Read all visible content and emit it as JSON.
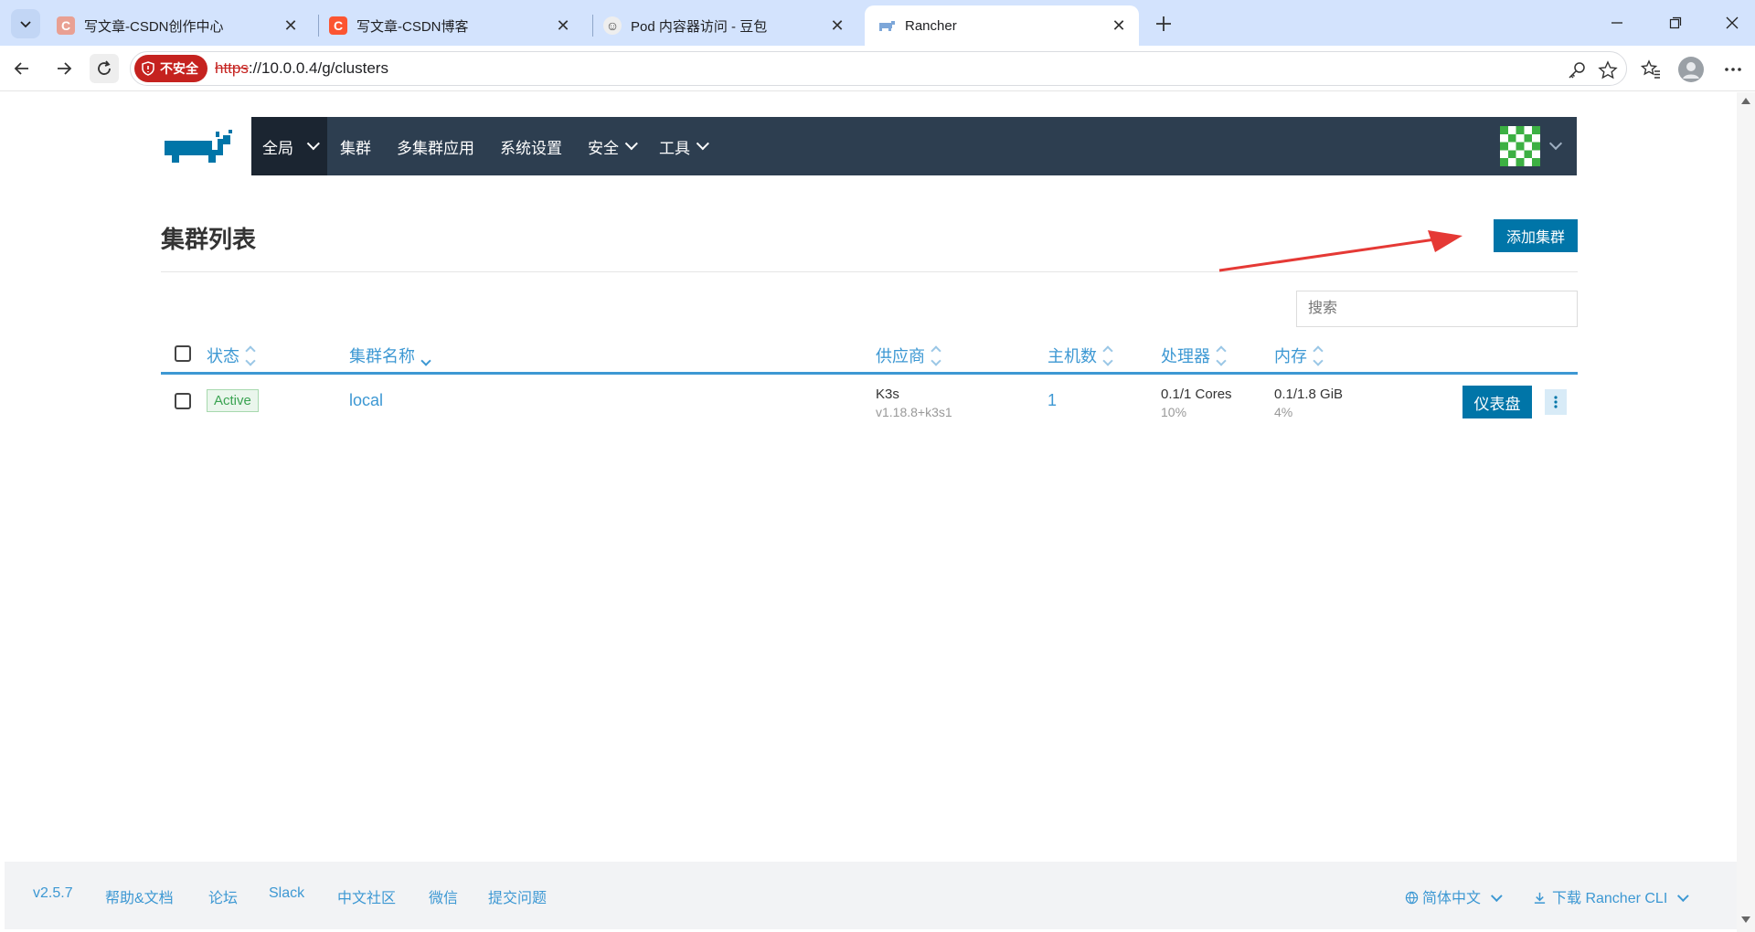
{
  "browser": {
    "tabs": [
      {
        "title": "写文章-CSDN创作中心",
        "favicon": "csdn-icon",
        "favicon_color": "#e9a093"
      },
      {
        "title": "写文章-CSDN博客",
        "favicon": "csdn-icon",
        "favicon_color": "#fc5531"
      },
      {
        "title": "Pod 内容器访问 - 豆包",
        "favicon": "doubao-icon",
        "favicon_color": "#444444"
      },
      {
        "title": "Rancher",
        "favicon": "rancher-icon",
        "favicon_color": "#7da7d9"
      }
    ],
    "security_label": "不安全",
    "url_scheme": "https",
    "url_rest": "://10.0.0.4/g/clusters"
  },
  "nav": {
    "items": [
      "全局",
      "集群",
      "多集群应用",
      "系统设置",
      "安全",
      "工具"
    ]
  },
  "page": {
    "title": "集群列表",
    "add_button": "添加集群",
    "search_placeholder": "搜索"
  },
  "table": {
    "headers": [
      "状态",
      "集群名称",
      "供应商",
      "主机数",
      "处理器",
      "内存"
    ],
    "rows": [
      {
        "state": "Active",
        "name": "local",
        "provider": "K3s",
        "provider_version": "v1.18.8+k3s1",
        "nodes": "1",
        "cpu": "0.1/1 Cores",
        "cpu_pct": "10%",
        "memory": "0.1/1.8 GiB",
        "memory_pct": "4%",
        "dashboard_button": "仪表盘"
      }
    ]
  },
  "footer": {
    "version": "v2.5.7",
    "links": [
      "帮助&文档",
      "论坛",
      "Slack",
      "中文社区",
      "微信",
      "提交问题"
    ],
    "language": "简体中文",
    "download": "下载 Rancher CLI"
  },
  "colors": {
    "nav_bg": "#2d3e50",
    "primary": "#0075a8",
    "link": "#3d98d3",
    "active_state": "#3aa351",
    "annotation_arrow": "#e53935"
  }
}
